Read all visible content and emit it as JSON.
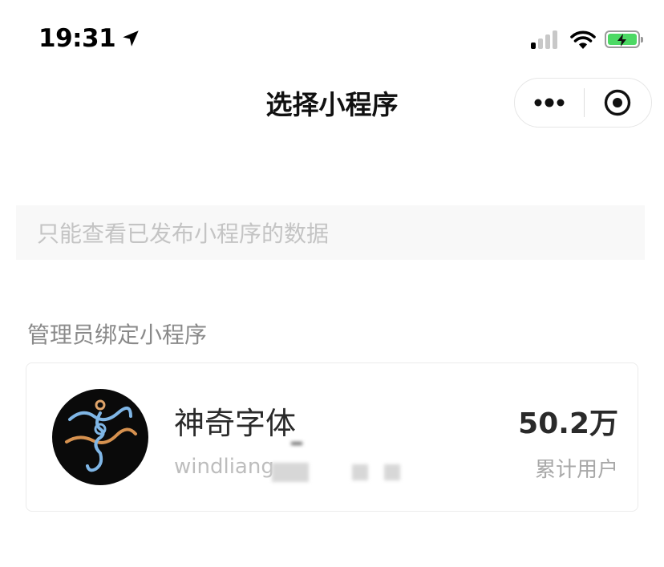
{
  "status_bar": {
    "time": "19:31",
    "signal_bars": 4,
    "signal_active": 1,
    "battery_charging": true,
    "colors": {
      "battery_fill": "#4cd964"
    }
  },
  "nav": {
    "title": "选择小程序",
    "more_icon": "more-dots-icon",
    "close_icon": "close-target-icon"
  },
  "notice": {
    "text": "只能查看已发布小程序的数据"
  },
  "section": {
    "title": "管理员绑定小程序"
  },
  "apps": [
    {
      "name": "神奇字体",
      "id": "windliang",
      "stat_value": "50.2万",
      "stat_label": "累计用户"
    }
  ]
}
